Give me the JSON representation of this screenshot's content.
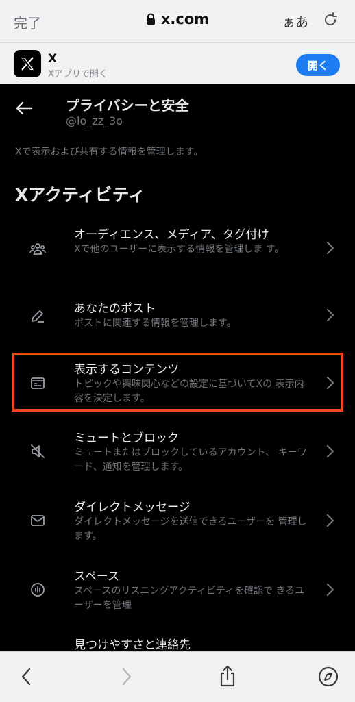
{
  "safari": {
    "done_label": "完了",
    "url": "x.com",
    "text_size_label": "ぁあ"
  },
  "banner": {
    "app_name": "X",
    "subtitle": "Xアプリで開く",
    "open_label": "開く"
  },
  "header": {
    "title": "プライバシーと安全",
    "handle": "@lo_zz_3o"
  },
  "description": "Xで表示および共有する情報を管理します。",
  "section": {
    "title": "Xアクティビティ",
    "items": [
      {
        "label": "オーディエンス、メディア、タグ付け",
        "sub": "Xで他のユーザーに表示する情報を管理しま す。",
        "icon": "people-icon"
      },
      {
        "label": "あなたのポスト",
        "sub": "ポストに関連する情報を管理します。",
        "icon": "pencil-icon"
      },
      {
        "label": "表示するコンテンツ",
        "sub": "トピックや興味関心などの設定に基づいてXの 表示内容を決定します。",
        "icon": "content-card-icon"
      },
      {
        "label": "ミュートとブロック",
        "sub": "ミュートまたはブロックしているアカウント、 キーワード、通知を管理します。",
        "icon": "mute-icon"
      },
      {
        "label": "ダイレクトメッセージ",
        "sub": "ダイレクトメッセージを送信できるユーザーを 管理します。",
        "icon": "envelope-icon"
      },
      {
        "label": "スペース",
        "sub": "スペースのリスニングアクティビティを確認で きるユーザーを管理",
        "icon": "spaces-icon"
      },
      {
        "label": "見つけやすさと連絡先",
        "sub": "",
        "icon": ""
      }
    ]
  },
  "colors": {
    "background": "#000000",
    "text_primary": "#e7e9ea",
    "text_secondary": "#71767b",
    "accent_button": "#1d7cf2",
    "highlight_box": "#ee4a1d",
    "safari_bar": "#f2f2f4"
  }
}
